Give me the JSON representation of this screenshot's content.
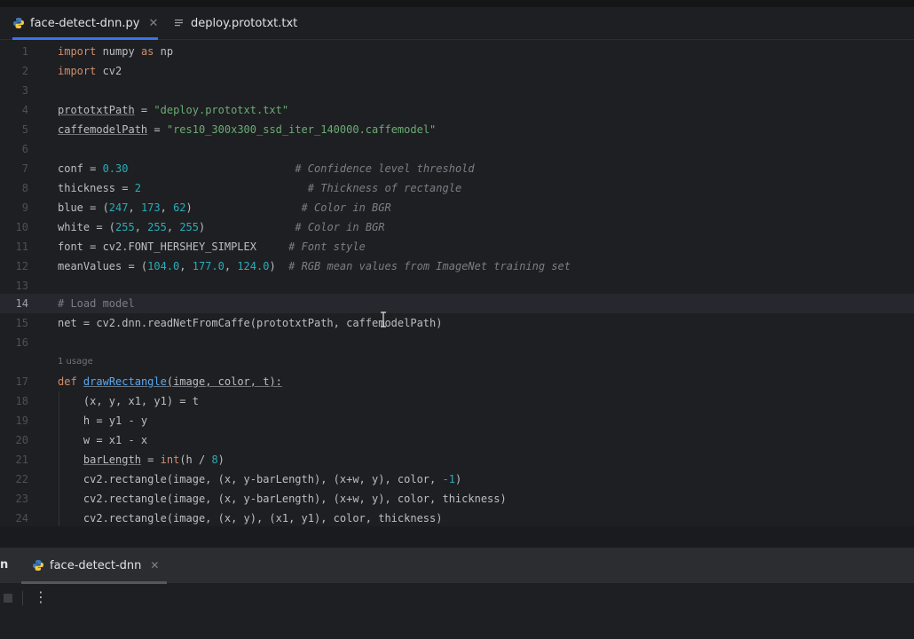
{
  "tabs": [
    {
      "label": "face-detect-dnn.py",
      "icon": "python-icon",
      "active": true
    },
    {
      "label": "deploy.prototxt.txt",
      "icon": "text-file-icon",
      "active": false
    }
  ],
  "gutter": [
    "1",
    "2",
    "3",
    "4",
    "5",
    "6",
    "7",
    "8",
    "9",
    "10",
    "11",
    "12",
    "13",
    "14",
    "15",
    "16",
    "17",
    "18",
    "19",
    "20",
    "21",
    "22",
    "23",
    "24"
  ],
  "current_line": "14",
  "usage_hint": "1 usage",
  "code": {
    "l1": [
      "import",
      " numpy ",
      "as",
      " np"
    ],
    "l2": [
      "import",
      " cv2"
    ],
    "l4": [
      "prototxtPath",
      " = ",
      "\"deploy.prototxt.txt\""
    ],
    "l5": [
      "caffemodelPath",
      " = ",
      "\"res10_300x300_ssd_iter_140000.caffemodel\""
    ],
    "l7": [
      "conf = ",
      "0.30",
      "                          ",
      "# Confidence level threshold"
    ],
    "l8": [
      "thickness = ",
      "2",
      "                          ",
      "# Thickness of rectangle"
    ],
    "l9": [
      "blue = (",
      "247",
      ", ",
      "173",
      ", ",
      "62",
      ")                 ",
      "# Color in BGR"
    ],
    "l10": [
      "white = (",
      "255",
      ", ",
      "255",
      ", ",
      "255",
      ")              ",
      "# Color in BGR"
    ],
    "l11": [
      "font = cv2.FONT_HERSHEY_SIMPLEX     ",
      "# Font style"
    ],
    "l12": [
      "meanValues = (",
      "104.0",
      ", ",
      "177.0",
      ", ",
      "124.0",
      ")  ",
      "# RGB mean values from ImageNet training set"
    ],
    "l14": [
      "# Load model"
    ],
    "l15": [
      "net = cv2.dnn.readNetFromCaffe(prototxtPath, caffemodelPath)"
    ],
    "l17": [
      "def",
      " ",
      "drawRectangle",
      "(image, color, t):"
    ],
    "l18": [
      "    (x, y, x1, y1) = t"
    ],
    "l19": [
      "    h = y1 - y"
    ],
    "l20": [
      "    w = x1 - x"
    ],
    "l21": [
      "    ",
      "barLength",
      " = ",
      "int",
      "(h / ",
      "8",
      ")"
    ],
    "l22": [
      "    cv2.rectangle(image, (x, y-barLength), (x+w, y), color, ",
      "-1",
      ")"
    ],
    "l23": [
      "    cv2.rectangle(image, (x, y-barLength), (x+w, y), color, thickness)"
    ],
    "l24": [
      "    cv2.rectangle(image, (x, y), (x1, y1), color, thickness)"
    ]
  },
  "run_panel": {
    "left_label": "n",
    "tab_label": "face-detect-dnn",
    "more_icon": "⋮",
    "console_text": ""
  },
  "colors": {
    "background": "#1e1f22",
    "keyword": "#cf8e6d",
    "string": "#6aab73",
    "number": "#2aacb8",
    "comment": "#7a7e85",
    "function": "#56a8f5",
    "accent": "#3574f0"
  }
}
